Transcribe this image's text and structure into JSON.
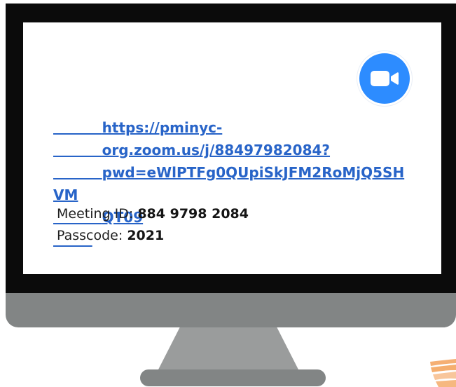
{
  "meeting": {
    "link_lines": [
      "https://pminyc-",
      "org.zoom.us/j/88497982084?",
      "pwd=eWlPTFg0QUpiSkJFM2RoMjQ5SHVM",
      "QT09"
    ],
    "meeting_id_label": "Meeting ID:",
    "meeting_id_value": "884 9798 2084",
    "passcode_label": "Passcode:",
    "passcode_value": "2021"
  },
  "icons": {
    "zoom": "zoom-video-camera-icon",
    "corner": "decorative-brush-stroke"
  },
  "colors": {
    "bezel": "#0b0b0b",
    "monitor_body": "#828585",
    "stand": "#9a9c9c",
    "link": "#2864c8",
    "zoom_blue": "#2d8cff",
    "accent_orange": "#f29a4a"
  }
}
